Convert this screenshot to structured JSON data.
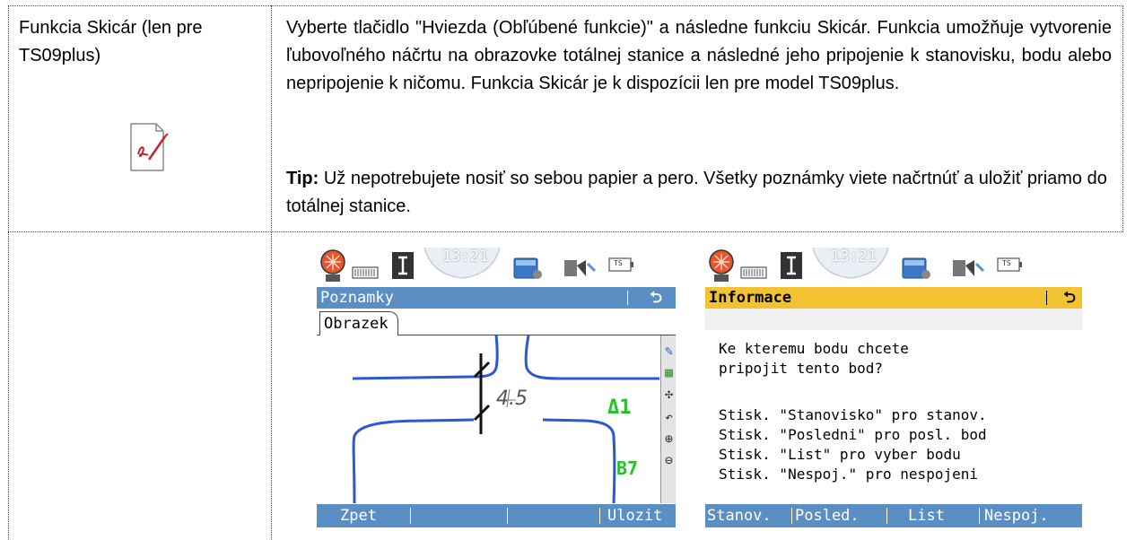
{
  "left_cell": {
    "title": "Funkcia Skicár (len pre TS09plus)"
  },
  "right_cell": {
    "description": "Vyberte tlačidlo \"Hviezda (Obľúbené funkcie)\" a následne funkciu Skicár. Funkcia umožňuje vytvorenie ľubovoľného náčrtu na obrazovke totálnej stanice a následné jeho pripojenie k stanovisku, bodu alebo nepripojenie k ničomu. Funkcia Skicár je k dispozícii len pre model TS09plus.",
    "tip_label": "Tip:",
    "tip_text": " Už nepotrebujete nosiť so sebou papier a pero. Všetky poznámky viete načrtnúť a uložiť priamo do totálnej stanice."
  },
  "screen_sketch": {
    "time": "13:21",
    "battery_label": "TS",
    "title": "Poznamky",
    "back_glyph": "⮌",
    "tab": "Obrazek",
    "sketch_number": "4.5",
    "point_label_1": "Δ1",
    "point_label_2": "B7",
    "softkeys": [
      "Zpet",
      "",
      "",
      "Ulozit"
    ],
    "accent_color": "#5b8fc4"
  },
  "screen_info": {
    "time": "13:21",
    "battery_label": "TS",
    "title": "Informace",
    "back_glyph": "⮌",
    "lines": [
      "Ke kteremu bodu chcete",
      "pripojit tento bod?",
      "",
      "Stisk. \"Stanovisko\" pro stanov.",
      "Stisk. \"Posledni\" pro posl. bod",
      "Stisk. \"List\" pro vyber bodu",
      "Stisk. \"Nespoj.\" pro nespojeni"
    ],
    "softkeys": [
      "Stanov.",
      "Posled.",
      "List",
      "Nespoj."
    ],
    "title_color": "#f2c230"
  }
}
